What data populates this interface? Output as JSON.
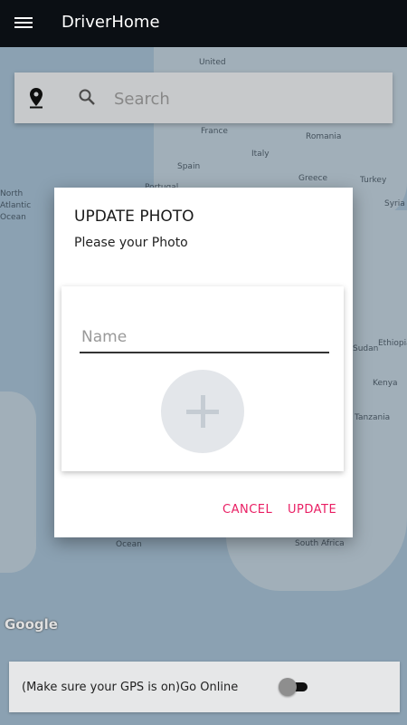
{
  "app_bar": {
    "title": "DriverHome",
    "menu_icon": "hamburger-menu-icon"
  },
  "map": {
    "labels": [
      "United",
      "France",
      "Romania",
      "Spain",
      "Italy",
      "Turkey",
      "Portugal",
      "Greece",
      "Syria",
      "North",
      "Atlantic",
      "Ocean",
      "Tanzania",
      "Kenya",
      "Ethiopia",
      "Sudan",
      "South Africa",
      "Ocean",
      "Google"
    ],
    "water_color": "#9fb8cb",
    "land_color": "#b8c8d3"
  },
  "search": {
    "placeholder": "Search",
    "pin_icon": "location-pin-icon",
    "search_icon": "search-icon"
  },
  "dialog": {
    "title": "UPDATE PHOTO",
    "message": "Please your Photo",
    "name_placeholder": "Name",
    "add_photo_icon": "plus-icon",
    "cancel_label": "CANCEL",
    "update_label": "UPDATE",
    "accent_color": "#e91e63"
  },
  "bottom_bar": {
    "label": "(Make sure your GPS is on)Go Online",
    "toggle_state": "off"
  }
}
